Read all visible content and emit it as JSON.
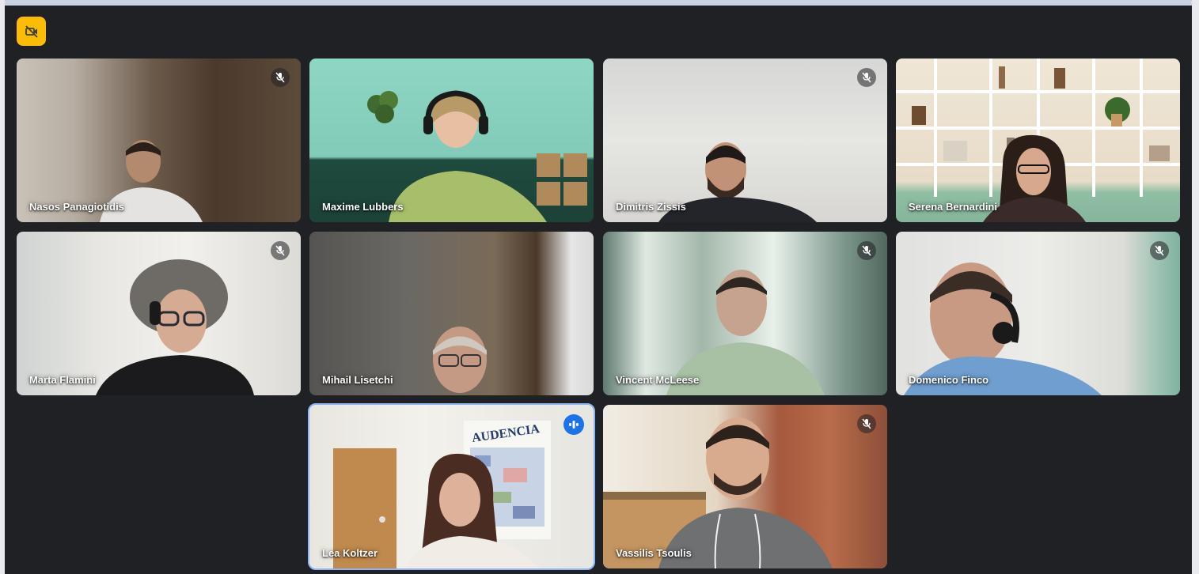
{
  "meeting": {
    "status_badge_icon": "video-off-icon",
    "accent_color": "#fbbc04",
    "speaking_outline_color": "#8ab4f8"
  },
  "participants": [
    {
      "name": "Nasos Panagiotidis",
      "muted": true,
      "speaking": false
    },
    {
      "name": "Maxime Lubbers",
      "muted": false,
      "speaking": false
    },
    {
      "name": "Dimitris Zissis",
      "muted": true,
      "speaking": false
    },
    {
      "name": "Serena Bernardini",
      "muted": false,
      "speaking": false
    },
    {
      "name": "Marta Flamini",
      "muted": true,
      "speaking": false
    },
    {
      "name": "Mihail Lisetchi",
      "muted": false,
      "speaking": false
    },
    {
      "name": "Vincent McLeese",
      "muted": true,
      "speaking": false
    },
    {
      "name": "Domenico Finco",
      "muted": true,
      "speaking": false
    },
    {
      "name": "Lea Koltzer",
      "muted": false,
      "speaking": true
    },
    {
      "name": "Vassilis Tsoulis",
      "muted": true,
      "speaking": false
    }
  ],
  "poster_text": "AUDENCIA"
}
